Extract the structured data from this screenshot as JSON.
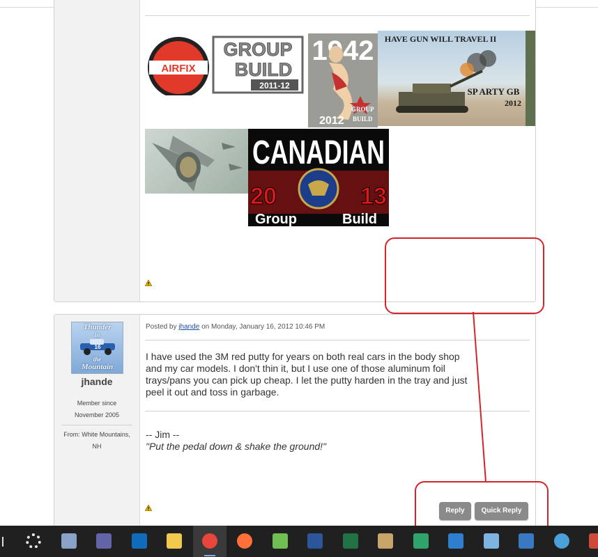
{
  "post1": {
    "signature_images": [
      {
        "name": "airfix-group-build",
        "brand": "AIRFIX",
        "line1": "GROUP",
        "line2": "BUILD",
        "year": "2011-12"
      },
      {
        "name": "1942-group-build",
        "year_top": "1942",
        "year_bottom": "2012",
        "caption1": "GROUP",
        "caption2": "BUILD"
      },
      {
        "name": "have-gun-will-travel",
        "title": "HAVE GUN WILL TRAVEL II",
        "subtitle": "SP ARTY GB",
        "year": "2012"
      },
      {
        "name": "canadian-group-build",
        "title": "CANADIAN",
        "year_left": "20",
        "year_right": "13",
        "left_text": "Group",
        "right_text": "Build"
      }
    ]
  },
  "post2": {
    "avatar_lines": [
      "Thunder",
      "in",
      "the",
      "Mountain"
    ],
    "avatar_car_number": "16",
    "username": "jhande",
    "member_since_label": "Member since",
    "member_since_date": "November 2005",
    "from_line1": "From: White Mountains,",
    "from_line2": "NH",
    "posted_by_prefix": "Posted by",
    "posted_by_user": "jhande",
    "posted_on": "on Monday, January 16, 2012 10:46 PM",
    "body": "I have used the 3M red putty for years on both real cars in the body shop and my car models. I don't thin it, but I use one of those aluminum foil trays/pans you can pick up cheap. I let the putty harden in the tray and just peel it out and toss in garbage.",
    "signature_name": "-- Jim --",
    "signature_quote": "\"Put the pedal down & shake the ground!\"",
    "reply_label": "Reply",
    "quick_reply_label": "Quick Reply"
  },
  "taskbar": {
    "icons": [
      "settings-icon",
      "notepad-icon",
      "teams-icon",
      "outlook-icon",
      "file-explorer-icon",
      "chrome-icon",
      "firefox-icon",
      "paint-icon",
      "word-icon",
      "excel-icon",
      "palette-icon",
      "snip-icon",
      "gear-app-icon",
      "network-icon",
      "remote-desktop-icon",
      "globe-icon",
      "app-icon"
    ],
    "active": "chrome-icon"
  },
  "colors": {
    "annotation": "#d2252b",
    "button": "#8a8a8a",
    "taskbar": "#202020",
    "link": "#1a4f9a"
  }
}
